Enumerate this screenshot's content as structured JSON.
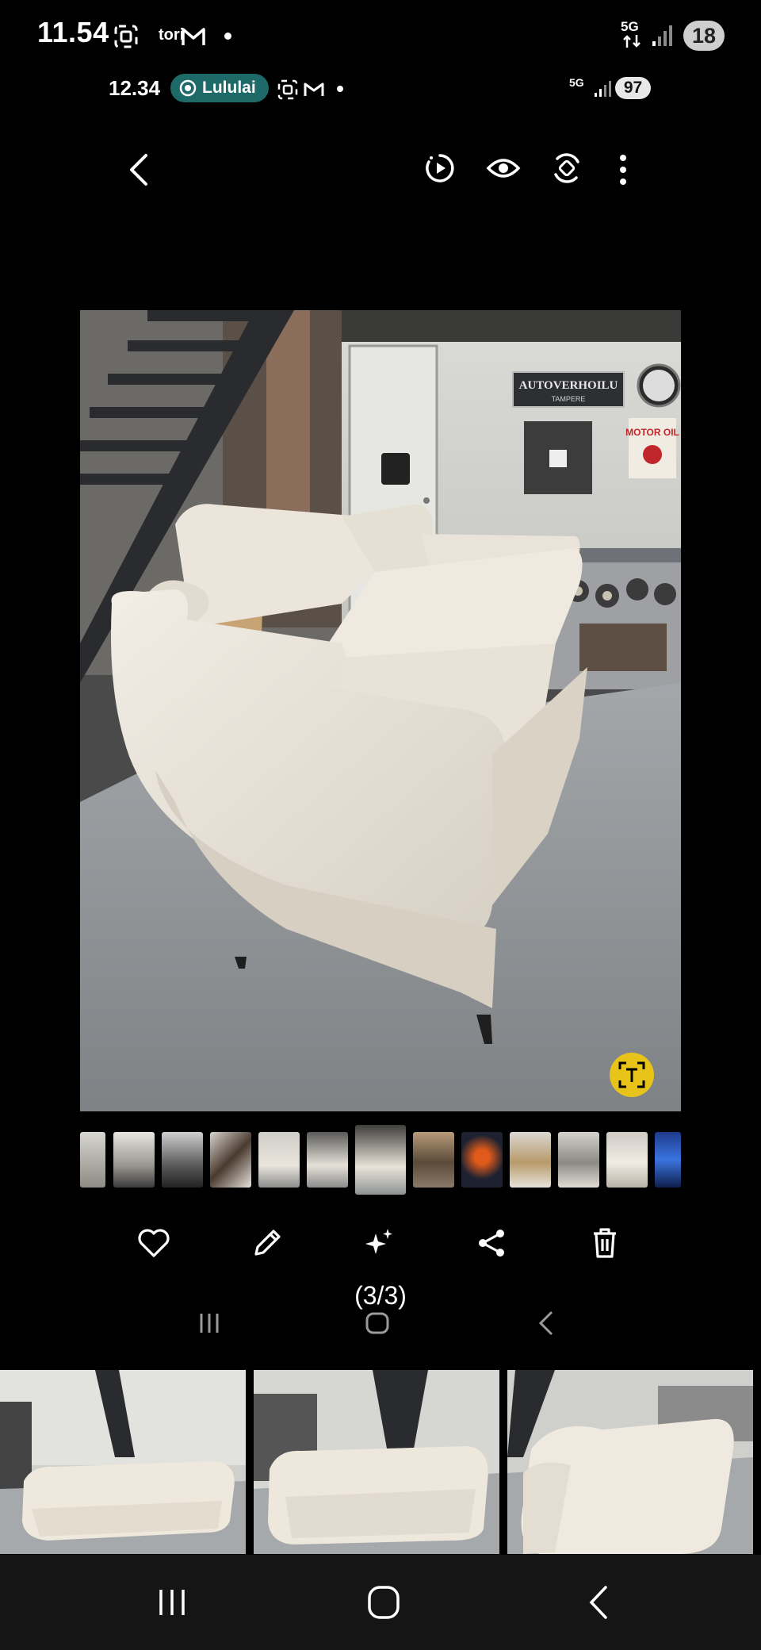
{
  "outer_status": {
    "time": "11.54",
    "app_label": "tori",
    "network": "5G",
    "badge": "18"
  },
  "inner_status": {
    "time": "12.34",
    "pill_label": "Lululai",
    "network": "5G",
    "battery": "97"
  },
  "viewer": {
    "counter": "(3/3)",
    "selected_thumbnail": 6,
    "sign_text": "AUTOVERHOILU",
    "sign_subtext": "TAMPERE",
    "poster_text": "MOTOR OIL"
  },
  "colors": {
    "pill": "#1e6a69",
    "scan_button": "#e8c41a",
    "sofa": "#ece6dc",
    "floor": "#8f9396"
  },
  "icons": {
    "back": "chevron-left-icon",
    "motion": "motion-photo-icon",
    "eye": "eye-icon",
    "remaster": "remaster-icon",
    "more": "more-vert-icon",
    "favorite": "heart-icon",
    "edit": "pencil-icon",
    "ai": "sparkle-icon",
    "share": "share-icon",
    "delete": "trash-icon"
  }
}
